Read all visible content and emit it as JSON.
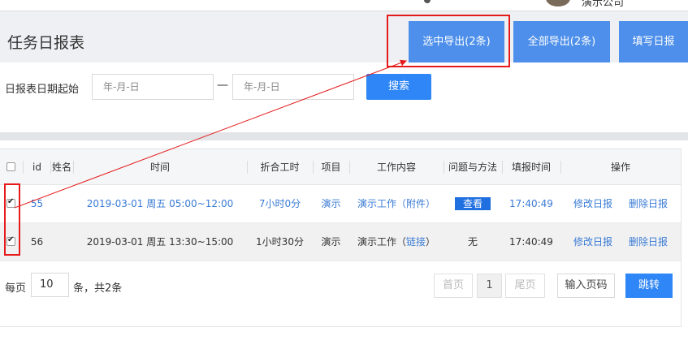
{
  "topbar": {
    "company": "演示公司"
  },
  "header": {
    "title": "任务日报表",
    "export_selected": "选中导出(2条)",
    "export_all": "全部导出(2条)",
    "fill_report": "填写日报"
  },
  "filter": {
    "label": "日报表日期起始",
    "from_placeholder": "年-月-日",
    "separator": "—",
    "to_placeholder": "年-月-日",
    "search": "搜索"
  },
  "table": {
    "headers": {
      "id": "id",
      "name": "姓名",
      "time": "时间",
      "hours": "折合工时",
      "project": "项目",
      "content": "工作内容",
      "issue": "问题与方法",
      "fill_time": "填报时间",
      "actions": "操作"
    },
    "rows": [
      {
        "checked": true,
        "id": "55",
        "time": "2019-03-01  周五  05:00~12:00",
        "hours": "7小时0分",
        "project": "演示",
        "content": "演示工作（附件）",
        "issue": "查看",
        "fill_time": "17:40:49",
        "edit": "修改日报",
        "delete": "删除日报"
      },
      {
        "checked": true,
        "id": "56",
        "time": "2019-03-01  周五  13:30~15:00",
        "hours": "1小时30分",
        "project": "演示",
        "content_prefix": "演示工作（",
        "content_link": "链接",
        "content_suffix": "）",
        "issue": "无",
        "fill_time": "17:40:49",
        "edit": "修改日报",
        "delete": "删除日报"
      }
    ]
  },
  "pager": {
    "per_page_label": "每页",
    "per_page_value": "10",
    "total_label": "条，共2条",
    "first": "首页",
    "current": "1",
    "last": "尾页",
    "jump_placeholder": "输入页码",
    "jump": "跳转"
  },
  "colors": {
    "accent": "#4d8fea",
    "primary_button": "#2f86f6",
    "annotation": "#e51b1b"
  }
}
